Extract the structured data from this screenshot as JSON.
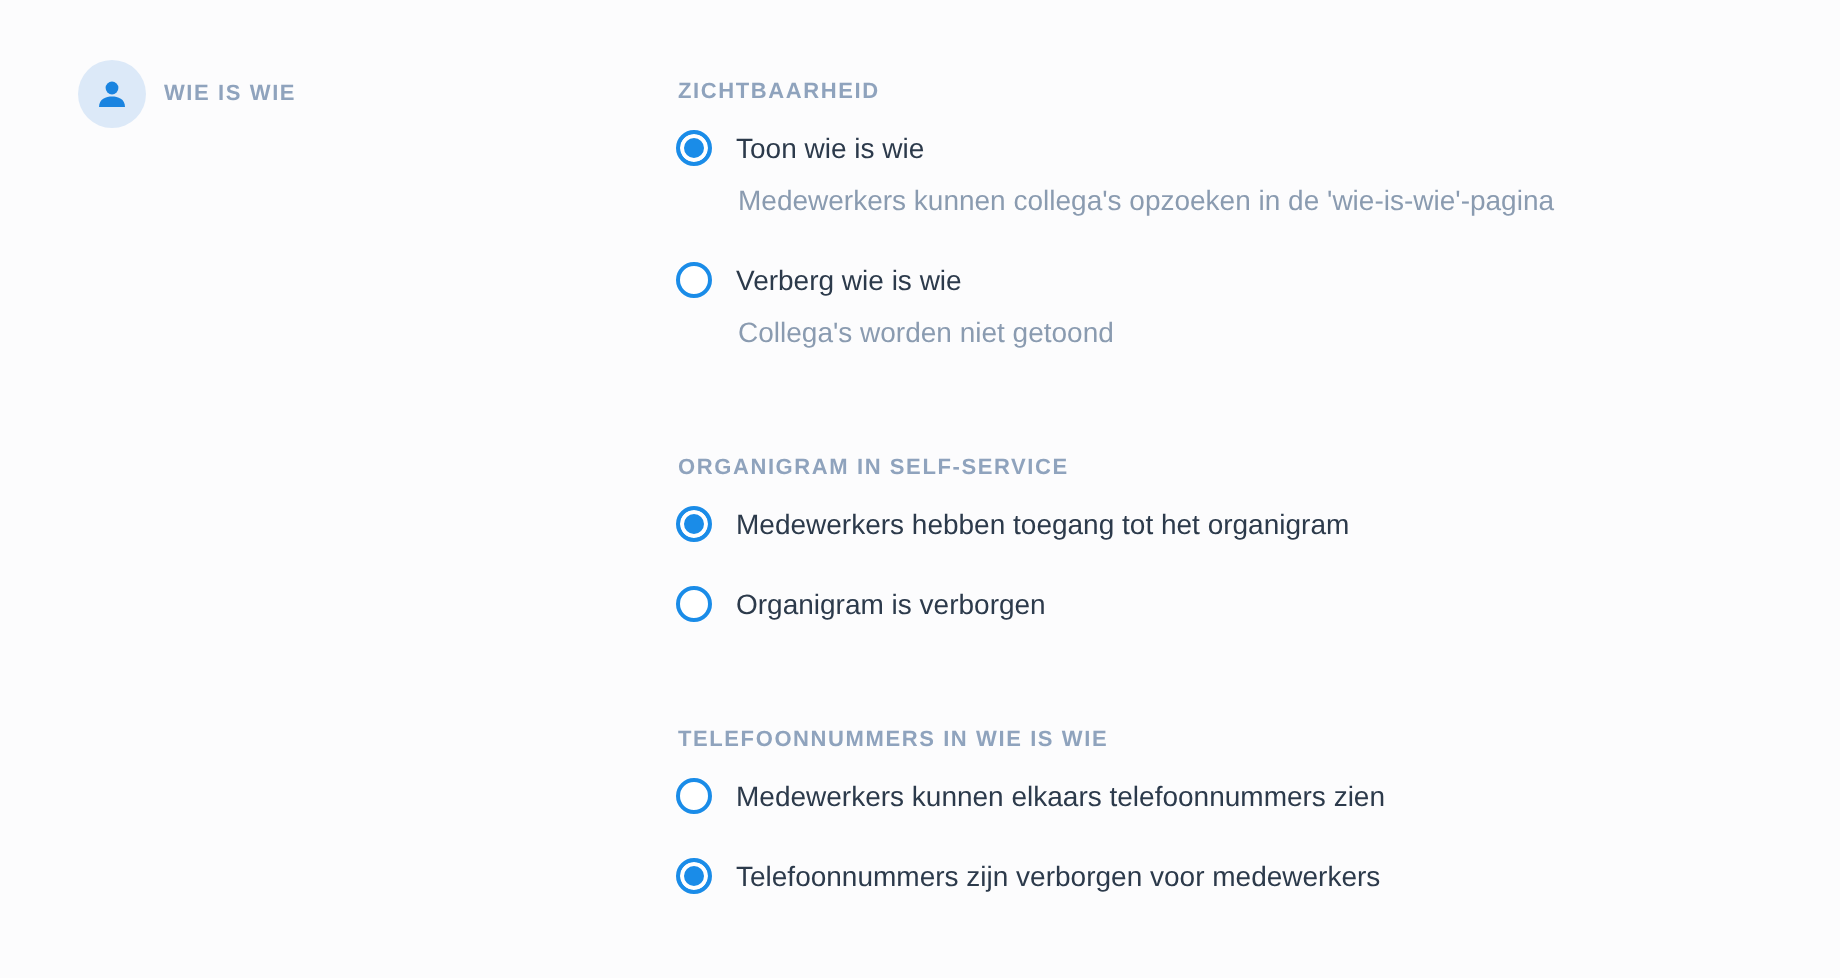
{
  "category": {
    "label": "WIE IS WIE"
  },
  "sections": [
    {
      "heading": "ZICHTBAARHEID",
      "options": [
        {
          "label": "Toon wie is wie",
          "description": "Medewerkers kunnen collega's opzoeken in de 'wie-is-wie'-pagina",
          "selected": true
        },
        {
          "label": "Verberg wie is wie",
          "description": "Collega's worden niet getoond",
          "selected": false
        }
      ]
    },
    {
      "heading": "ORGANIGRAM IN SELF-SERVICE",
      "options": [
        {
          "label": "Medewerkers hebben toegang tot het organigram",
          "selected": true
        },
        {
          "label": "Organigram is verborgen",
          "selected": false
        }
      ]
    },
    {
      "heading": "TELEFOONNUMMERS IN WIE IS WIE",
      "options": [
        {
          "label": "Medewerkers kunnen elkaars telefoonnummers zien",
          "selected": false
        },
        {
          "label": "Telefoonnummers zijn verborgen voor medewerkers",
          "selected": true
        }
      ]
    }
  ]
}
